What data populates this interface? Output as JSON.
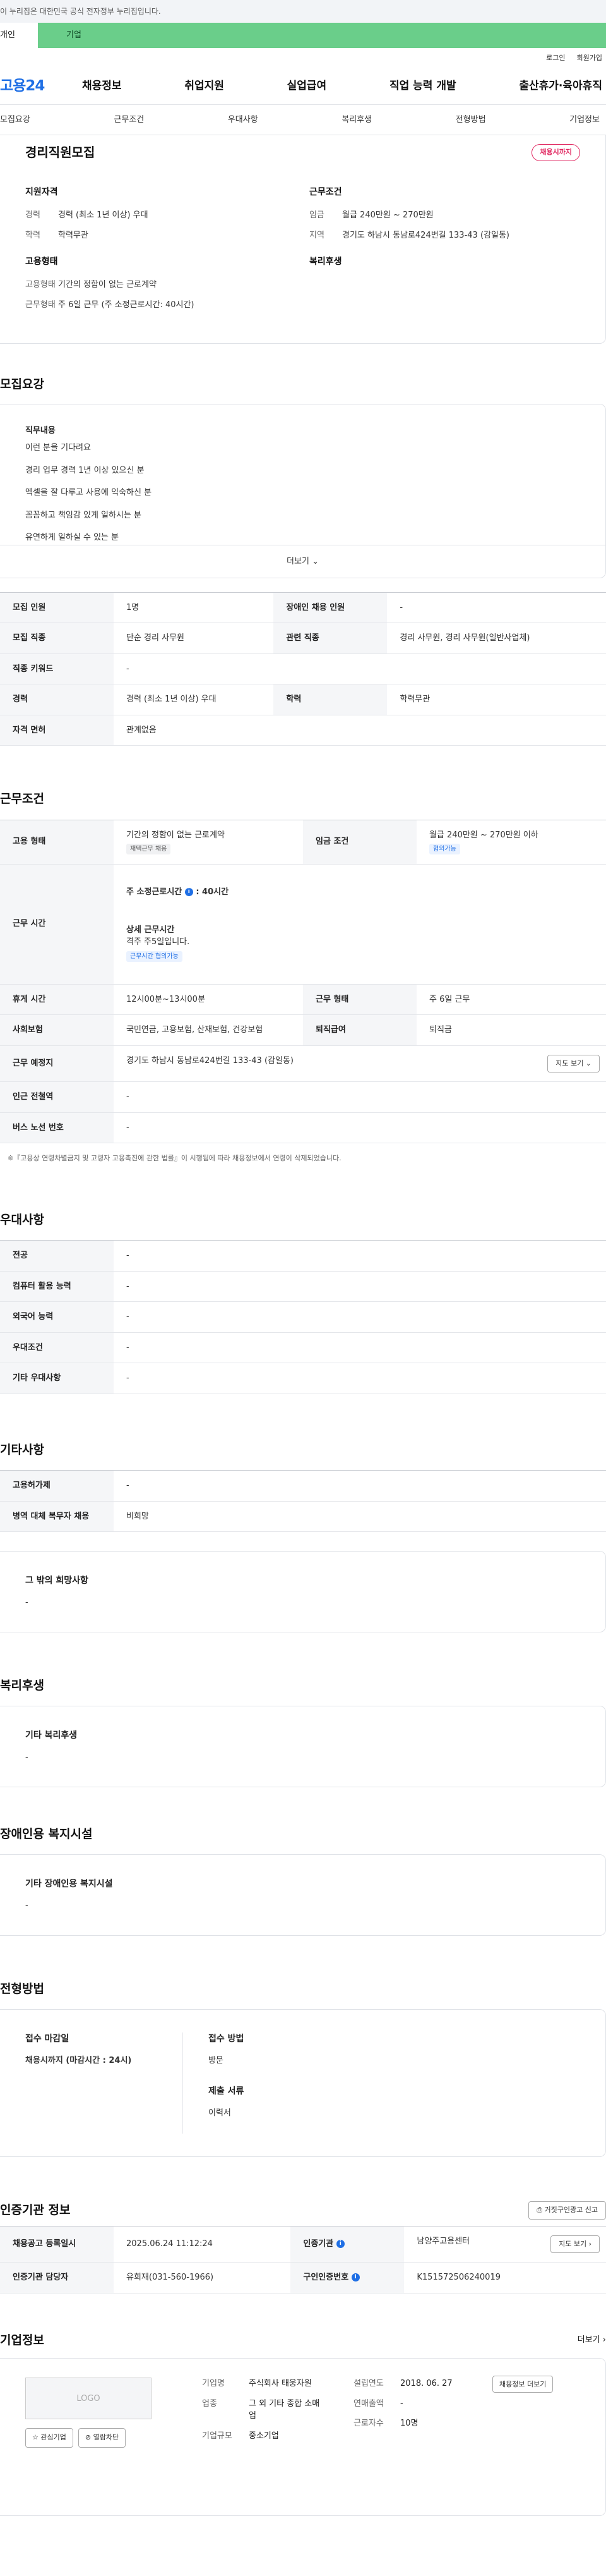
{
  "header": {
    "gov_notice": "이 누리집은 대한민국 공식 전자정부 누리집입니다.",
    "tab_personal": "개인",
    "tab_company": "기업",
    "login": "로그인",
    "signup": "회원가입",
    "logo_main": "고용",
    "logo_num": "24",
    "gnb": [
      "채용정보",
      "취업지원",
      "실업급여",
      "직업 능력 개발",
      "출산휴가·육아휴직"
    ]
  },
  "anchors": [
    "모집요강",
    "근무조건",
    "우대사항",
    "복리후생",
    "전형방법",
    "기업정보"
  ],
  "summary": {
    "title": "경리직원모집",
    "badge": "채용시까지",
    "qual_title": "지원자격",
    "exp_k": "경력",
    "exp_v": "경력 (최소 1년 이상) 우대",
    "edu_k": "학력",
    "edu_v": "학력무관",
    "work_title": "근무조건",
    "wage_k": "임금",
    "wage_v": "월급 240만원 ~ 270만원",
    "region_k": "지역",
    "region_v": "경기도 하남시 동남로424번길 133-43 (감일동)",
    "emp_title": "고용형태",
    "emp_k": "고용형태",
    "emp_v": "기간의 정함이 없는 근로계약",
    "hours_k": "근무형태",
    "hours_v": "주 6일 근무 (주 소정근로시간: 40시간)",
    "welfare_title": "복리후생"
  },
  "recruit": {
    "title": "모집요강",
    "duty_title": "직무내용",
    "duties": [
      "이런 분을 기다려요",
      "경리 업무 경력 1년 이상 있으신 분",
      "엑셀을 잘 다루고 사용에 익숙하신 분",
      "꼼꼼하고 책임감 있게 일하시는 분",
      "유연하게 일하실 수 있는 분"
    ],
    "more": "더보기",
    "rows": [
      {
        "h1": "모집 인원",
        "v1": "1명",
        "h2": "장애인 채용 인원",
        "v2": "-"
      },
      {
        "h1": "모집 직종",
        "v1": "단순 경리 사무원",
        "h2": "관련 직종",
        "v2": "경리 사무원, 경리 사무원(일반사업체)"
      },
      {
        "h1": "직종 키워드",
        "v1": "-"
      },
      {
        "h1": "경력",
        "v1": "경력 (최소 1년 이상) 우대",
        "h2": "학력",
        "v2": "학력무관"
      },
      {
        "h1": "자격 면허",
        "v1": "관계없음"
      }
    ]
  },
  "conditions": {
    "title": "근무조건",
    "emp_h": "고용 형태",
    "emp_v": "기간의 정함이 없는 근로계약",
    "emp_chip": "재택근무 채용",
    "wage_h": "임금 조건",
    "wage_v": "월급 240만원 ~ 270만원 이하",
    "wage_chip": "협의가능",
    "hours_h": "근무 시간",
    "hours_base": "주 소정근로시간",
    "hours_base_info": "i",
    "hours_base_v": ": 40시간",
    "hours_detail_t": "상세 근무시간",
    "hours_detail_v": "격주 주5일입니다.",
    "hours_chip": "근무시간 협의가능",
    "break_h": "휴게 시간",
    "break_v": "12시00분~13시00분",
    "type_h": "근무 형태",
    "type_v": "주 6일 근무",
    "ins_h": "사회보험",
    "ins_v": "국민연금, 고용보험, 산재보험, 건강보험",
    "ret_h": "퇴직급여",
    "ret_v": "퇴직금",
    "place_h": "근무 예정지",
    "place_v": "경기도 하남시 동남로424번길 133-43 (감일동)",
    "map_btn": "지도 보기",
    "subway_h": "인근 전철역",
    "subway_v": "-",
    "bus_h": "버스 노선 번호",
    "bus_v": "-",
    "footnote": "※『고용상 연령차별금지 및 고령자 고용촉진에 관한 법률』이 시행됨에 따라 채용정보에서 연령이 삭제되었습니다."
  },
  "preference": {
    "title": "우대사항",
    "rows": [
      {
        "h": "전공",
        "v": "-"
      },
      {
        "h": "컴퓨터 활용 능력",
        "v": "-"
      },
      {
        "h": "외국어 능력",
        "v": "-"
      },
      {
        "h": "우대조건",
        "v": "-"
      },
      {
        "h": "기타 우대사항",
        "v": "-"
      }
    ]
  },
  "etc": {
    "title": "기타사항",
    "rows": [
      {
        "h": "고용허가제",
        "v": "-"
      },
      {
        "h": "병역 대체 복무자 채용",
        "v": "비희망"
      }
    ],
    "hope_title": "그 밖의 희망사항",
    "hope_v": "-"
  },
  "welfare": {
    "title": "복리후생",
    "box_title": "기타 복리후생",
    "box_v": "-"
  },
  "disabled": {
    "title": "장애인용 복지시설",
    "box_title": "기타 장애인용 복지시설",
    "box_v": "-"
  },
  "apply": {
    "title": "전형방법",
    "deadline_t": "접수 마감일",
    "deadline_v": "채용시까지 (마감시간 : 24시)",
    "method_t": "접수 방법",
    "method_v": "방문",
    "docs_t": "제출 서류",
    "docs_v": "이력서"
  },
  "agency": {
    "title": "인증기관 정보",
    "report_btn": "거짓구인광고 신고",
    "reg_h": "채용공고 등록일시",
    "reg_v": "2025.06.24 11:12:24",
    "org_h": "인증기관",
    "org_v": "남양주고용센터",
    "org_btn": "지도 보기",
    "mgr_h": "인증기관 담당자",
    "mgr_v": "유희재(031-560-1966)",
    "id_h": "구인인증번호",
    "id_v": "K151572506240019"
  },
  "company": {
    "title": "기업정보",
    "more": "더보기",
    "logo": "LOGO",
    "fav_btn": "관심기업",
    "block_btn": "열람차단",
    "name_k": "기업명",
    "name_v": "주식회사 태웅자원",
    "ind_k": "업종",
    "ind_v": "그 외 기타 종합 소매업",
    "size_k": "기업규모",
    "size_v": "중소기업",
    "est_k": "설립연도",
    "est_v": "2018. 06. 27",
    "sales_k": "연매출액",
    "sales_v": "-",
    "emp_k": "근로자수",
    "emp_v": "10명",
    "jobs_btn": "채용정보 더보기"
  }
}
